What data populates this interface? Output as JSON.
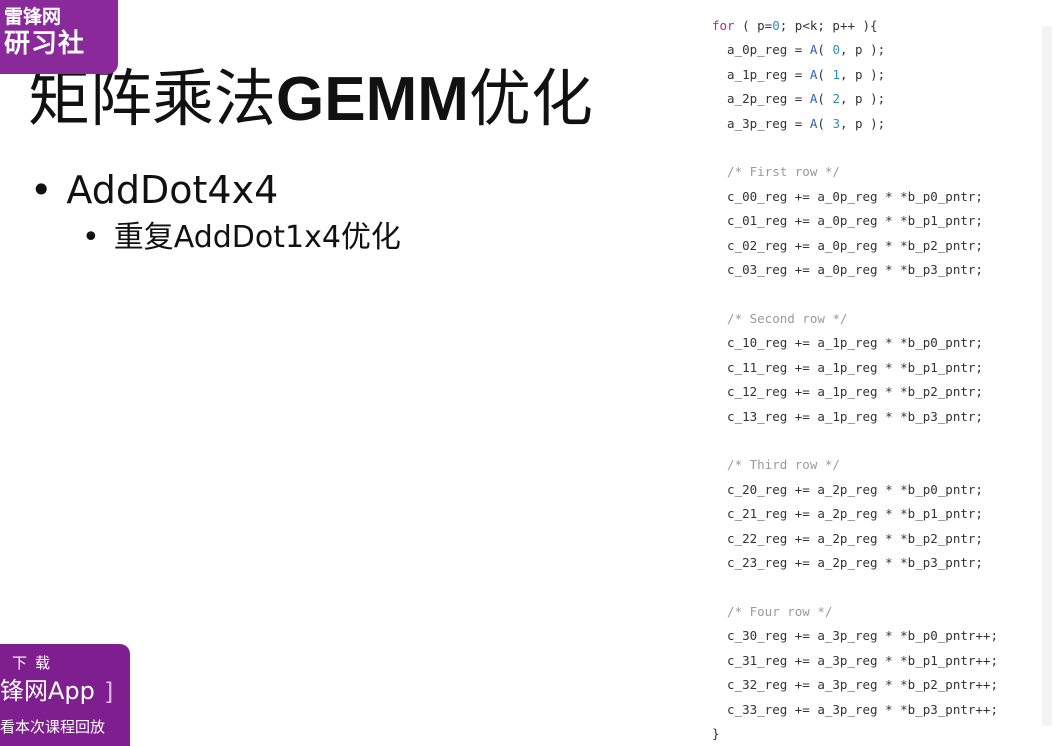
{
  "logo": {
    "line1": "雷锋网",
    "line2": "研习社"
  },
  "slide": {
    "title_prefix": "矩阵乘法",
    "title_latin": "GEMM",
    "title_suffix": "优化",
    "bullet_dot": "•",
    "bullet1": "AddDot4x4",
    "bullet2": "重复AddDot1x4优化"
  },
  "code": {
    "for_keyword": "for",
    "for_rest": " ( p=",
    "for_zero": "0",
    "for_tail": "; p<k; p++ ){",
    "a_loads": [
      {
        "lhs": "  a_0p_reg = ",
        "fn": "A",
        "open": "( ",
        "idx": "0",
        "tail": ", p );"
      },
      {
        "lhs": "  a_1p_reg = ",
        "fn": "A",
        "open": "( ",
        "idx": "1",
        "tail": ", p );"
      },
      {
        "lhs": "  a_2p_reg = ",
        "fn": "A",
        "open": "( ",
        "idx": "2",
        "tail": ", p );"
      },
      {
        "lhs": "  a_3p_reg = ",
        "fn": "A",
        "open": "( ",
        "idx": "3",
        "tail": ", p );"
      }
    ],
    "comment_first": "  /* First row */",
    "row0": [
      "  c_00_reg += a_0p_reg * *b_p0_pntr;",
      "  c_01_reg += a_0p_reg * *b_p1_pntr;",
      "  c_02_reg += a_0p_reg * *b_p2_pntr;",
      "  c_03_reg += a_0p_reg * *b_p3_pntr;"
    ],
    "comment_second": "  /* Second row */",
    "row1": [
      "  c_10_reg += a_1p_reg * *b_p0_pntr;",
      "  c_11_reg += a_1p_reg * *b_p1_pntr;",
      "  c_12_reg += a_1p_reg * *b_p2_pntr;",
      "  c_13_reg += a_1p_reg * *b_p3_pntr;"
    ],
    "comment_third": "  /* Third row */",
    "row2": [
      "  c_20_reg += a_2p_reg * *b_p0_pntr;",
      "  c_21_reg += a_2p_reg * *b_p1_pntr;",
      "  c_22_reg += a_2p_reg * *b_p2_pntr;",
      "  c_23_reg += a_2p_reg * *b_p3_pntr;"
    ],
    "comment_four": "  /* Four row */",
    "row3": [
      "  c_30_reg += a_3p_reg * *b_p0_pntr++;",
      "  c_31_reg += a_3p_reg * *b_p1_pntr++;",
      "  c_32_reg += a_3p_reg * *b_p2_pntr++;",
      "  c_33_reg += a_3p_reg * *b_p3_pntr++;"
    ],
    "closing": "}"
  },
  "download": {
    "small": "下载",
    "app": "锋网App",
    "bracket": "]",
    "tip": "看本次课程回放"
  },
  "colors": {
    "brand_purple": "#8a2a9a",
    "keyword": "#b0307a",
    "function": "#2a5fb0",
    "number": "#2e8fb5",
    "comment": "#9a9a9a"
  }
}
